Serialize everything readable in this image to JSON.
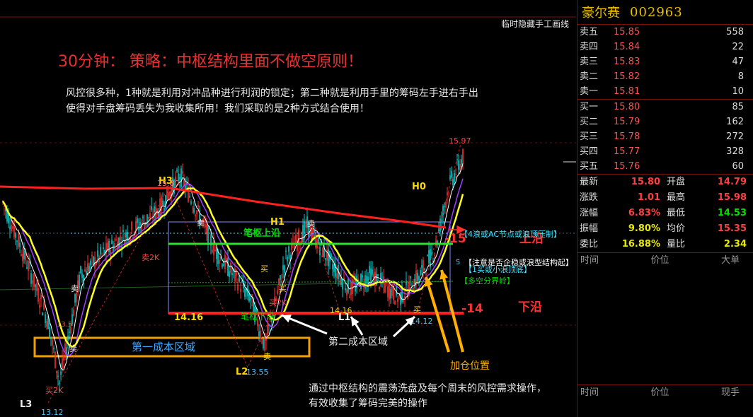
{
  "chart_data": {
    "type": "candlestick",
    "toolbar_label": "临时隐藏手工画线",
    "heading": "30分钟： 策略：中枢结构里面不做空原则！",
    "desc_line1": "风控很多种，1种就是利用对冲品种进行利润的锁定；第二种就是利用手里的筹码左手进右手出",
    "desc_line2": "使得对手盘筹码丢失为我收集所用！我们采取的是2种方式结合使用！",
    "bottom_note1": "通过中枢结构的震荡洗盘及每个周末的风控需求操作，",
    "bottom_note2": "有效收集了筹码完美的操作",
    "ylim": [
      12.8,
      16.2
    ],
    "price_high": "15.97",
    "upper_line_label": "笔枢上沿",
    "lower_line_label": "笔枢下沿",
    "lower_price": "14.16",
    "lower_price2": "14.16",
    "lower_edge_tag": "-14",
    "lower_edge_text": "下沿",
    "upper_edge_tag": "-15",
    "upper_edge_text": "上沿",
    "zone1_label": "第一成本区域",
    "zone2_label": "第二成本区域",
    "add_pos_label": "加仓位置",
    "hints": [
      "【4浪或AC节点或浪顶压制】",
      "【注意是否企稳或浪型结构起】",
      "【1买或小浪顶底】",
      "【多空分界岭】"
    ],
    "pivots": [
      {
        "tag": "L3",
        "price": "13.12"
      },
      {
        "tag": "H3",
        "price": "15.80"
      },
      {
        "tag": "H1",
        "price": ""
      },
      {
        "tag": "L2",
        "price": "13.55"
      },
      {
        "tag": "L1",
        "price": "14.16"
      },
      {
        "tag": "H0",
        "price": ""
      },
      {
        "tag": "L0",
        "price": "14.12"
      }
    ],
    "signals": [
      "买2K",
      "卖2K",
      "买2K",
      "卖",
      "卖",
      "买",
      "卖",
      "卖",
      "买",
      "卖",
      "买",
      "13.5",
      "5"
    ]
  },
  "panel": {
    "name": "豪尔赛",
    "code": "002963",
    "asks": [
      {
        "label": "卖五",
        "price": "15.85",
        "vol": "558"
      },
      {
        "label": "卖四",
        "price": "15.84",
        "vol": "22"
      },
      {
        "label": "卖三",
        "price": "15.83",
        "vol": "47"
      },
      {
        "label": "卖二",
        "price": "15.82",
        "vol": "8"
      },
      {
        "label": "卖一",
        "price": "15.81",
        "vol": "10"
      }
    ],
    "bids": [
      {
        "label": "买一",
        "price": "15.80",
        "vol": "85"
      },
      {
        "label": "买二",
        "price": "15.79",
        "vol": "162"
      },
      {
        "label": "买三",
        "price": "15.78",
        "vol": "272"
      },
      {
        "label": "买四",
        "price": "15.77",
        "vol": "328"
      },
      {
        "label": "买五",
        "price": "15.76",
        "vol": "60"
      }
    ],
    "stats": [
      {
        "l1": "最新",
        "v1": "15.80",
        "l2": "开盘",
        "v2": "14.79"
      },
      {
        "l1": "涨跌",
        "v1": "1.01",
        "l2": "最高",
        "v2": "15.98"
      },
      {
        "l1": "涨幅",
        "v1": "6.83%",
        "l2": "最低",
        "v2": "14.53"
      },
      {
        "l1": "振幅",
        "v1": "9.80%",
        "l2": "均价",
        "v2": "15.35"
      },
      {
        "l1": "委比",
        "v1": "16.88%",
        "l2": "量比",
        "v2": "2.34"
      }
    ],
    "tick_header": [
      "时间",
      "价位",
      "大单"
    ],
    "trade_header": [
      "时间",
      "价位",
      "现手"
    ]
  }
}
